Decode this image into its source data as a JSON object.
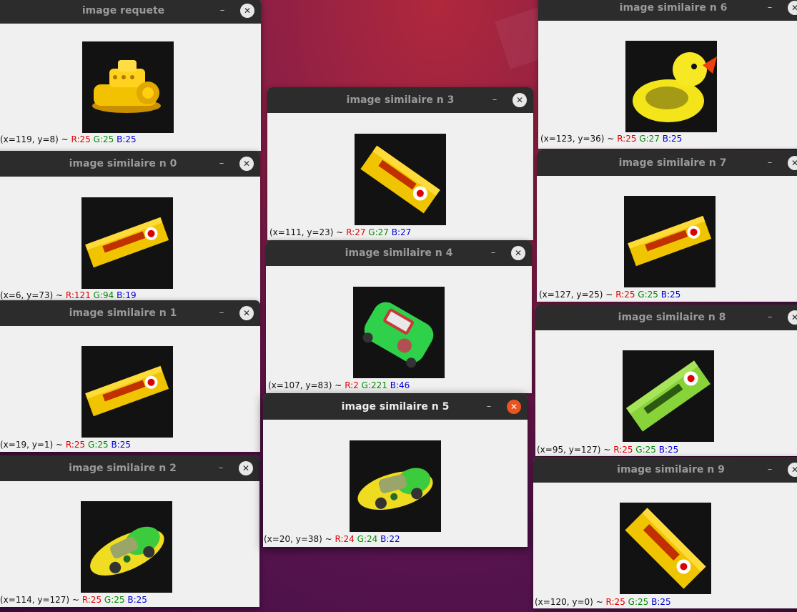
{
  "windows": {
    "query": {
      "title": "image requete",
      "coords": "(x=119, y=8) ~",
      "r": "R:25",
      "g": "G:25",
      "b": "B:25",
      "thumbnail": "yellow-boat-toy"
    },
    "n0": {
      "title": "image similaire n 0",
      "coords": "(x=6, y=73) ~",
      "r": "R:121",
      "g": "G:94",
      "b": "B:19",
      "thumbnail": "yellow-gum-pack"
    },
    "n1": {
      "title": "image similaire n 1",
      "coords": "(x=19, y=1) ~",
      "r": "R:25",
      "g": "G:25",
      "b": "B:25",
      "thumbnail": "yellow-gum-pack"
    },
    "n2": {
      "title": "image similaire n 2",
      "coords": "(x=114, y=127) ~",
      "r": "R:25",
      "g": "G:25",
      "b": "B:25",
      "thumbnail": "yellow-green-toy-car"
    },
    "n3": {
      "title": "image similaire n 3",
      "coords": "(x=111, y=23) ~",
      "r": "R:27",
      "g": "G:27",
      "b": "B:27",
      "thumbnail": "yellow-gum-pack"
    },
    "n4": {
      "title": "image similaire n 4",
      "coords": "(x=107, y=83) ~",
      "r": "R:2",
      "g": "G:221",
      "b": "B:46",
      "thumbnail": "green-toy-car"
    },
    "n5": {
      "title": "image similaire n 5",
      "coords": "(x=20, y=38) ~",
      "r": "R:24",
      "g": "G:24",
      "b": "B:22",
      "thumbnail": "yellow-green-toy-car"
    },
    "n6": {
      "title": "image similaire n 6",
      "coords": "(x=123, y=36) ~",
      "r": "R:25",
      "g": "G:27",
      "b": "B:25",
      "thumbnail": "rubber-duck"
    },
    "n7": {
      "title": "image similaire n 7",
      "coords": "(x=127, y=25) ~",
      "r": "R:25",
      "g": "G:25",
      "b": "B:25",
      "thumbnail": "yellow-gum-pack"
    },
    "n8": {
      "title": "image similaire n 8",
      "coords": "(x=95, y=127) ~",
      "r": "R:25",
      "g": "G:25",
      "b": "B:25",
      "thumbnail": "green-gum-pack"
    },
    "n9": {
      "title": "image similaire n 9",
      "coords": "(x=120, y=0) ~",
      "r": "R:25",
      "g": "G:25",
      "b": "B:25",
      "thumbnail": "yellow-gum-pack"
    }
  },
  "controls": {
    "minimize": "–",
    "close": "✕"
  },
  "colors": {
    "close_focused": "#e95420",
    "titlebar": "#2c2c2c",
    "red_value": "#e00000",
    "green_value": "#008a00",
    "blue_value": "#0000d8"
  }
}
